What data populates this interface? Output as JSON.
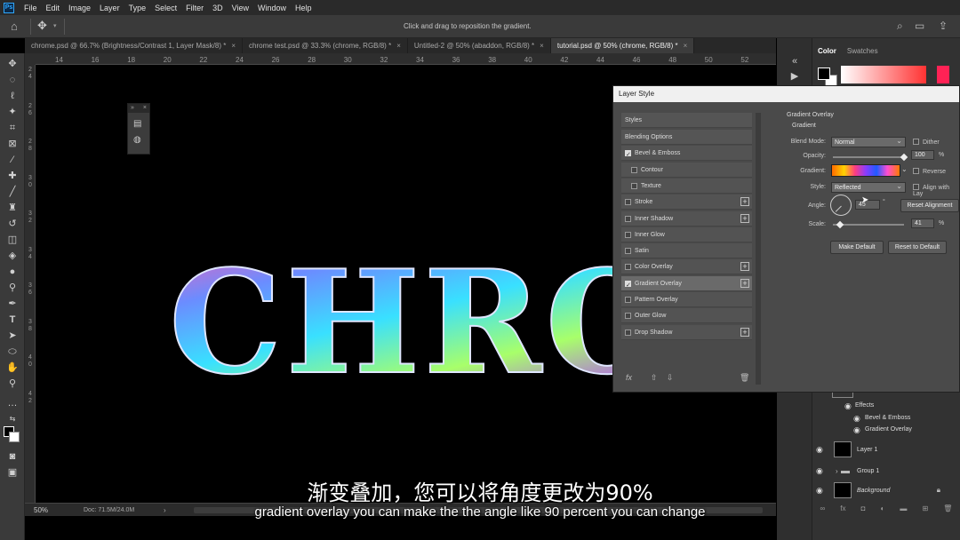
{
  "menubar": {
    "app_logo": "Ps",
    "items": [
      "File",
      "Edit",
      "Image",
      "Layer",
      "Type",
      "Select",
      "Filter",
      "3D",
      "View",
      "Window",
      "Help"
    ]
  },
  "options_bar": {
    "hint": "Click and drag to reposition the gradient.",
    "icons": [
      "home-icon",
      "move-icon",
      "search-icon",
      "workspace-icon",
      "share-icon"
    ]
  },
  "tabs": [
    {
      "label": "chrome.psd @ 66.7% (Brightness/Contrast 1, Layer Mask/8) *",
      "close": "×",
      "active": false
    },
    {
      "label": "chrome test.psd @ 33.3% (chrome, RGB/8) *",
      "close": "×",
      "active": false
    },
    {
      "label": "Untitled-2 @ 50% (abaddon, RGB/8) *",
      "close": "×",
      "active": false
    },
    {
      "label": "tutorial.psd @ 50% (chrome, RGB/8) *",
      "close": "×",
      "active": true
    }
  ],
  "ruler": {
    "top": [
      "14",
      "16",
      "18",
      "20",
      "22",
      "24",
      "26",
      "28",
      "30",
      "32",
      "34",
      "36",
      "38",
      "40",
      "42",
      "44",
      "46",
      "48",
      "50",
      "52"
    ],
    "left": [
      "2",
      "4",
      "2",
      "6",
      "2",
      "8",
      "3",
      "0",
      "3",
      "2",
      "3",
      "4",
      "3",
      "6",
      "3",
      "8",
      "4",
      "0",
      "4",
      "2"
    ]
  },
  "canvas": {
    "artwork_text": "CHROM",
    "gradient_colors": [
      "#ff5fb0",
      "#6b8cff",
      "#39e0ff",
      "#a8ff6a",
      "#b44dff",
      "#ff9a3c"
    ]
  },
  "status": {
    "zoom": "50%",
    "doc": "Doc: 71.5M/24.0M",
    "arrow": "›"
  },
  "color_panel": {
    "tabs": [
      "Color",
      "Swatches"
    ],
    "foreground": "#000000",
    "background": "#ffffff",
    "hue": "#ff2255"
  },
  "dialog": {
    "title": "Layer Style",
    "styles": [
      {
        "label": "Styles",
        "type": "header"
      },
      {
        "label": "Blending Options",
        "type": "header"
      },
      {
        "label": "Bevel & Emboss",
        "checked": true,
        "plus": false
      },
      {
        "label": "Contour",
        "checked": false,
        "indent": true
      },
      {
        "label": "Texture",
        "checked": false,
        "indent": true
      },
      {
        "label": "Stroke",
        "checked": false,
        "plus": true
      },
      {
        "label": "Inner Shadow",
        "checked": false,
        "plus": true
      },
      {
        "label": "Inner Glow",
        "checked": false,
        "plus": false
      },
      {
        "label": "Satin",
        "checked": false,
        "plus": false
      },
      {
        "label": "Color Overlay",
        "checked": false,
        "plus": true
      },
      {
        "label": "Gradient Overlay",
        "checked": true,
        "plus": true,
        "active": true
      },
      {
        "label": "Pattern Overlay",
        "checked": false,
        "plus": false
      },
      {
        "label": "Outer Glow",
        "checked": false,
        "plus": false
      },
      {
        "label": "Drop Shadow",
        "checked": false,
        "plus": true
      }
    ],
    "fx_label": "fx",
    "settings": {
      "section": "Gradient Overlay",
      "group": "Gradient",
      "blend_mode_label": "Blend Mode:",
      "blend_mode": "Normal",
      "dither_label": "Dither",
      "opacity_label": "Opacity:",
      "opacity": "100",
      "opacity_fraction": 1.0,
      "percent": "%",
      "gradient_label": "Gradient:",
      "reverse_label": "Reverse",
      "style_label": "Style:",
      "style": "Reflected",
      "align_label": "Align with Lay",
      "angle_label": "Angle:",
      "angle": "45",
      "degree": "°",
      "reset_alignment": "Reset Alignment",
      "scale_label": "Scale:",
      "scale": "41",
      "scale_fraction": 0.1,
      "make_default": "Make Default",
      "reset_default": "Reset to Default"
    }
  },
  "layers": {
    "effects_label": "Effects",
    "effects": [
      "Bevel & Emboss",
      "Gradient Overlay"
    ],
    "items": [
      {
        "name": "Layer 1",
        "italic": false
      },
      {
        "name": "Group 1",
        "italic": false,
        "folder": true
      },
      {
        "name": "Background",
        "italic": true,
        "locked": true
      }
    ]
  },
  "subtitles": {
    "chinese": "渐变叠加，您可以将角度更改为90%",
    "english": "gradient overlay you can make the the angle like 90 percent you can change"
  }
}
